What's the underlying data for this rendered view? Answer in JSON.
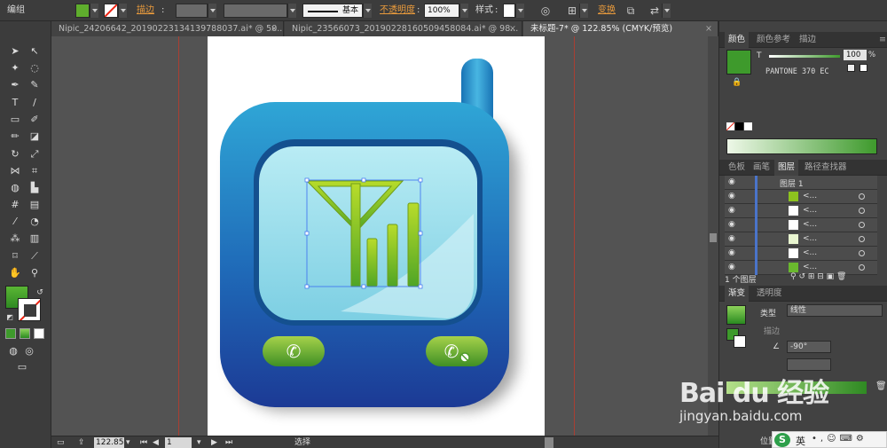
{
  "control_bar": {
    "group_label": "编组",
    "stroke_label": "描边",
    "stroke_style": "基本",
    "opacity_label": "不透明度",
    "opacity_value": "100%",
    "style_label": "样式",
    "transform_label": "变换"
  },
  "tabs": [
    {
      "label": "Nipic_24206642_20190223134139788037.ai* @ 50...",
      "active": false
    },
    {
      "label": "Nipic_23566073_20190228160509458084.ai* @ 98...",
      "active": false
    },
    {
      "label": "未标题-7* @ 122.85% (CMYK/预览)",
      "active": true
    }
  ],
  "status_bar": {
    "zoom": "122.85",
    "page": "1",
    "tool_status": "选择"
  },
  "color_panel": {
    "tabs": [
      "颜色",
      "颜色参考",
      "描边"
    ],
    "tint_label": "T",
    "tint_value": "100",
    "tint_unit": "%",
    "swatch_name": "PANTONE 370 EC",
    "swatch_color": "#3e9a2c"
  },
  "layers_panel": {
    "tabs": [
      "色板",
      "画笔",
      "图层",
      "路径查找器"
    ],
    "top_layer": "图层 1",
    "sublayers": [
      "<...",
      "<...",
      "<...",
      "<...",
      "<...",
      "<..."
    ],
    "footer": "1 个图层"
  },
  "gradient_panel": {
    "tabs": [
      "渐变",
      "透明度"
    ],
    "type_label": "类型",
    "type_value": "线性",
    "stroke_label": "描边",
    "angle_value": "-90°",
    "location_label": "位置"
  },
  "watermark": {
    "brand": "Bai du 经验",
    "url": "jingyan.baidu.com"
  },
  "ime": {
    "lang": "英"
  },
  "artwork_colors": {
    "body_top": "#2a9bd1",
    "body_bottom": "#1e3f9c",
    "screen": "#8fd7e6",
    "green": "#8dc21f"
  }
}
